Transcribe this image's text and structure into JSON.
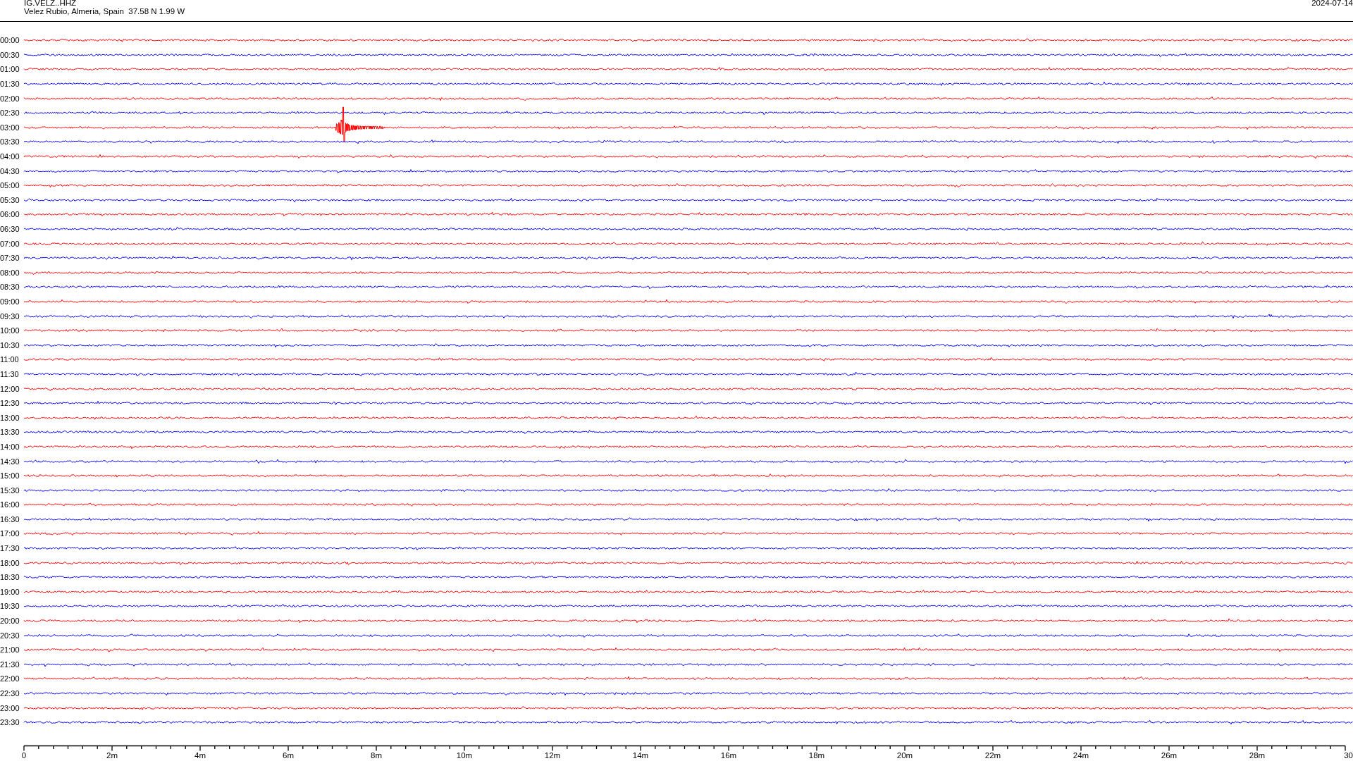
{
  "header": {
    "station": "IG.VELZ..HHZ",
    "location": "Velez Rubio, Almeria, Spain  37.58 N 1.99 W",
    "date": "2024-07-14"
  },
  "rows": [
    {
      "label": "00:00",
      "color": "#ff0000",
      "event": false
    },
    {
      "label": "00:30",
      "color": "#0000ff",
      "event": false
    },
    {
      "label": "01:00",
      "color": "#ff0000",
      "event": false
    },
    {
      "label": "01:30",
      "color": "#0000ff",
      "event": false
    },
    {
      "label": "02:00",
      "color": "#ff0000",
      "event": false
    },
    {
      "label": "02:30",
      "color": "#0000ff",
      "event": false
    },
    {
      "label": "03:00",
      "color": "#ff0000",
      "event": true
    },
    {
      "label": "03:30",
      "color": "#0000ff",
      "event": false
    },
    {
      "label": "04:00",
      "color": "#ff0000",
      "event": false
    },
    {
      "label": "04:30",
      "color": "#0000ff",
      "event": false
    },
    {
      "label": "05:00",
      "color": "#ff0000",
      "event": false
    },
    {
      "label": "05:30",
      "color": "#0000ff",
      "event": false
    },
    {
      "label": "06:00",
      "color": "#ff0000",
      "event": false
    },
    {
      "label": "06:30",
      "color": "#0000ff",
      "event": false
    },
    {
      "label": "07:00",
      "color": "#ff0000",
      "event": false
    },
    {
      "label": "07:30",
      "color": "#0000ff",
      "event": false
    },
    {
      "label": "08:00",
      "color": "#ff0000",
      "event": false
    },
    {
      "label": "08:30",
      "color": "#0000ff",
      "event": false
    },
    {
      "label": "09:00",
      "color": "#ff0000",
      "event": false
    },
    {
      "label": "09:30",
      "color": "#0000ff",
      "event": false
    },
    {
      "label": "10:00",
      "color": "#ff0000",
      "event": false
    },
    {
      "label": "10:30",
      "color": "#0000ff",
      "event": false
    },
    {
      "label": "11:00",
      "color": "#ff0000",
      "event": false
    },
    {
      "label": "11:30",
      "color": "#0000ff",
      "event": false
    },
    {
      "label": "12:00",
      "color": "#ff0000",
      "event": false
    },
    {
      "label": "12:30",
      "color": "#0000ff",
      "event": false
    },
    {
      "label": "13:00",
      "color": "#ff0000",
      "event": false
    },
    {
      "label": "13:30",
      "color": "#0000ff",
      "event": false
    },
    {
      "label": "14:00",
      "color": "#ff0000",
      "event": false
    },
    {
      "label": "14:30",
      "color": "#0000ff",
      "event": false
    },
    {
      "label": "15:00",
      "color": "#ff0000",
      "event": false
    },
    {
      "label": "15:30",
      "color": "#0000ff",
      "event": false
    },
    {
      "label": "16:00",
      "color": "#ff0000",
      "event": false
    },
    {
      "label": "16:30",
      "color": "#0000ff",
      "event": false
    },
    {
      "label": "17:00",
      "color": "#ff0000",
      "event": false
    },
    {
      "label": "17:30",
      "color": "#0000ff",
      "event": false
    },
    {
      "label": "18:00",
      "color": "#ff0000",
      "event": false
    },
    {
      "label": "18:30",
      "color": "#0000ff",
      "event": false
    },
    {
      "label": "19:00",
      "color": "#ff0000",
      "event": false
    },
    {
      "label": "19:30",
      "color": "#0000ff",
      "event": false
    },
    {
      "label": "20:00",
      "color": "#ff0000",
      "event": false
    },
    {
      "label": "20:30",
      "color": "#0000ff",
      "event": false
    },
    {
      "label": "21:00",
      "color": "#ff0000",
      "event": false
    },
    {
      "label": "21:30",
      "color": "#0000ff",
      "event": false
    },
    {
      "label": "22:00",
      "color": "#ff0000",
      "event": false
    },
    {
      "label": "22:30",
      "color": "#0000ff",
      "event": false
    },
    {
      "label": "23:00",
      "color": "#ff0000",
      "event": false
    },
    {
      "label": "23:30",
      "color": "#0000ff",
      "event": false
    }
  ],
  "axis": {
    "ticks": [
      "0",
      "2m",
      "4m",
      "6m",
      "8m",
      "10m",
      "12m",
      "14m",
      "16m",
      "18m",
      "20m",
      "22m",
      "24m",
      "26m",
      "28m",
      "30"
    ]
  }
}
